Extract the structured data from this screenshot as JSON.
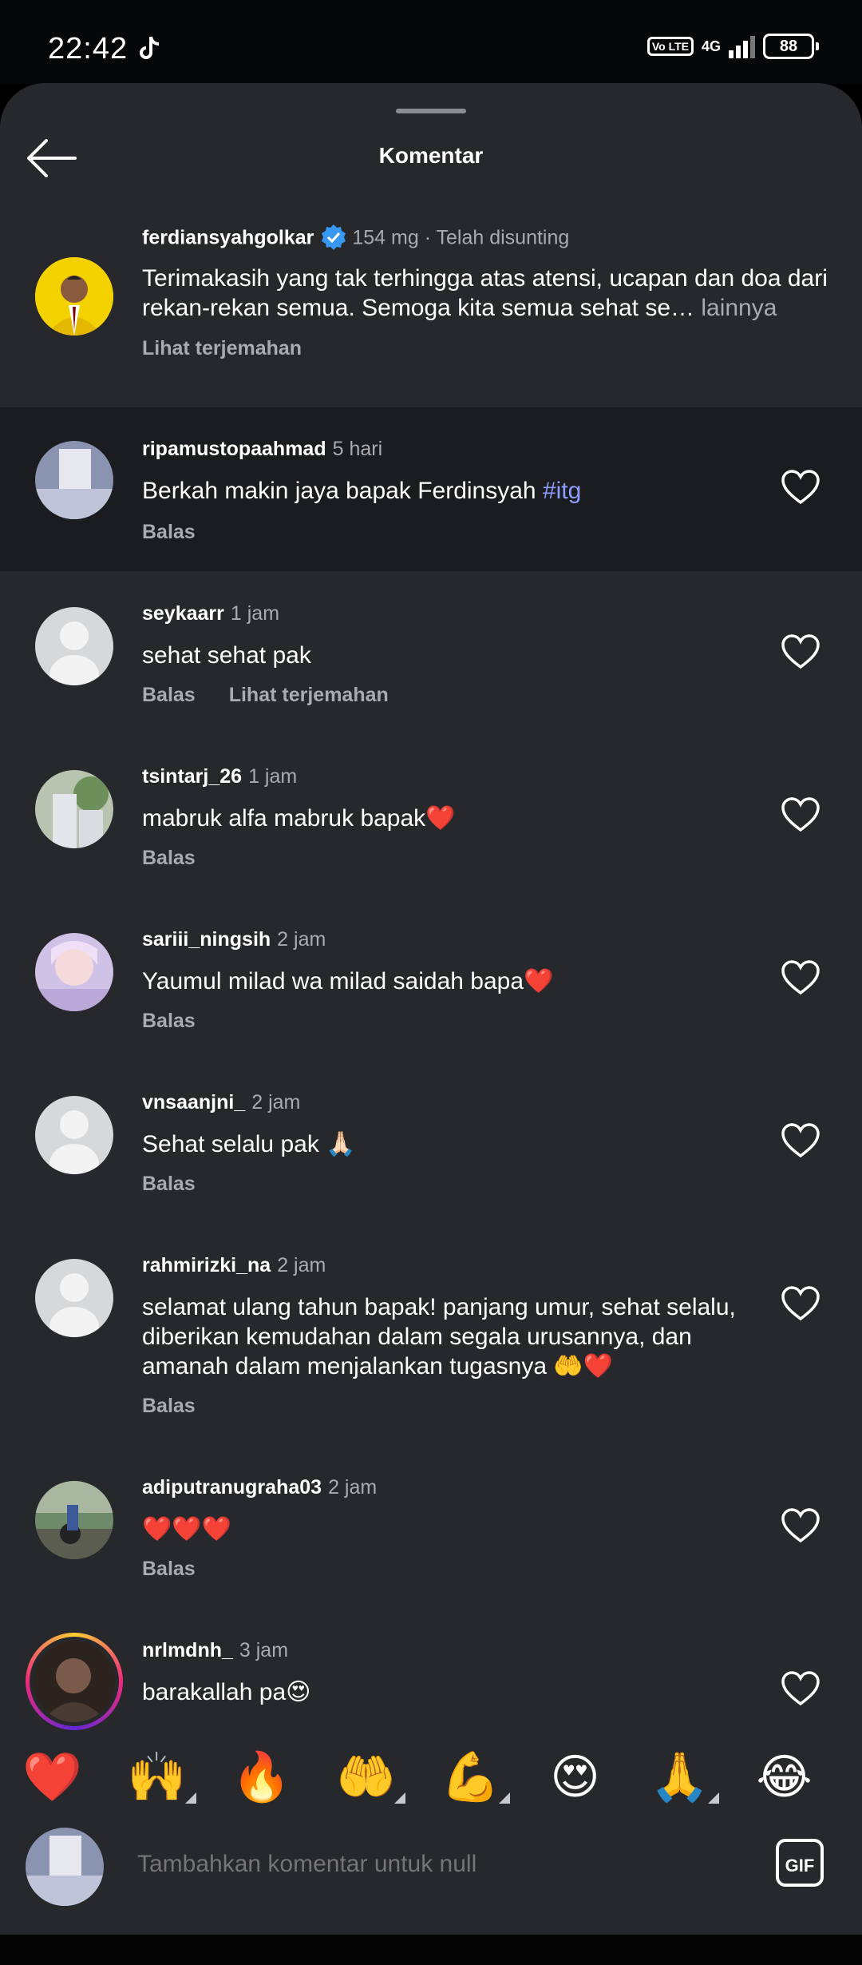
{
  "status_bar": {
    "time": "22:42",
    "volte": "Vo LTE",
    "network": "4G",
    "battery": "88"
  },
  "header": {
    "title": "Komentar"
  },
  "caption": {
    "username": "ferdiansyahgolkar",
    "meta": "154 mg · Telah disunting",
    "text": "Terimakasih yang tak terhingga atas atensi, ucapan dan doa dari rekan-rekan semua. Semoga kita semua sehat se…",
    "more": " lainnya",
    "translate": "Lihat terjemahan"
  },
  "comments": [
    {
      "username": "ripamustopaahmad",
      "time": "5 hari",
      "text": "Berkah makin jaya bapak Ferdinsyah ",
      "hashtag": "#itg",
      "reply": "Balas"
    },
    {
      "username": "seykaarr",
      "time": "1 jam",
      "text": "sehat sehat pak",
      "reply": "Balas",
      "translate": "Lihat terjemahan"
    },
    {
      "username": "tsintarj_26",
      "time": "1 jam",
      "text": "mabruk alfa mabruk bapak❤️",
      "reply": "Balas"
    },
    {
      "username": "sariii_ningsih",
      "time": "2 jam",
      "text": "Yaumul milad wa milad saidah bapa❤️",
      "reply": "Balas"
    },
    {
      "username": "vnsaanjni_",
      "time": "2 jam",
      "text": "Sehat selalu pak 🙏🏻",
      "reply": "Balas"
    },
    {
      "username": "rahmirizki_na",
      "time": "2 jam",
      "text": "selamat ulang tahun bapak! panjang umur, sehat selalu, diberikan kemudahan dalam segala urusannya, dan amanah dalam menjalankan tugasnya 🤲❤️",
      "reply": "Balas"
    },
    {
      "username": "adiputranugraha03",
      "time": "2 jam",
      "text": "❤️❤️❤️",
      "reply": "Balas"
    },
    {
      "username": "nrlmdnh_",
      "time": "3 jam",
      "text": "barakallah pa😍"
    }
  ],
  "emoji_bar": [
    "❤️",
    "🙌",
    "🔥",
    "🤲",
    "💪",
    "😍",
    "🙏",
    "😂"
  ],
  "composer": {
    "placeholder": "Tambahkan komentar untuk null",
    "gif_label": "GIF"
  },
  "colors": {
    "sheet": "#26282c",
    "highlight": "#1b1c1f",
    "hashtag": "#8d9cff",
    "secondary": "#a8abb0",
    "verified": "#3897f0"
  }
}
